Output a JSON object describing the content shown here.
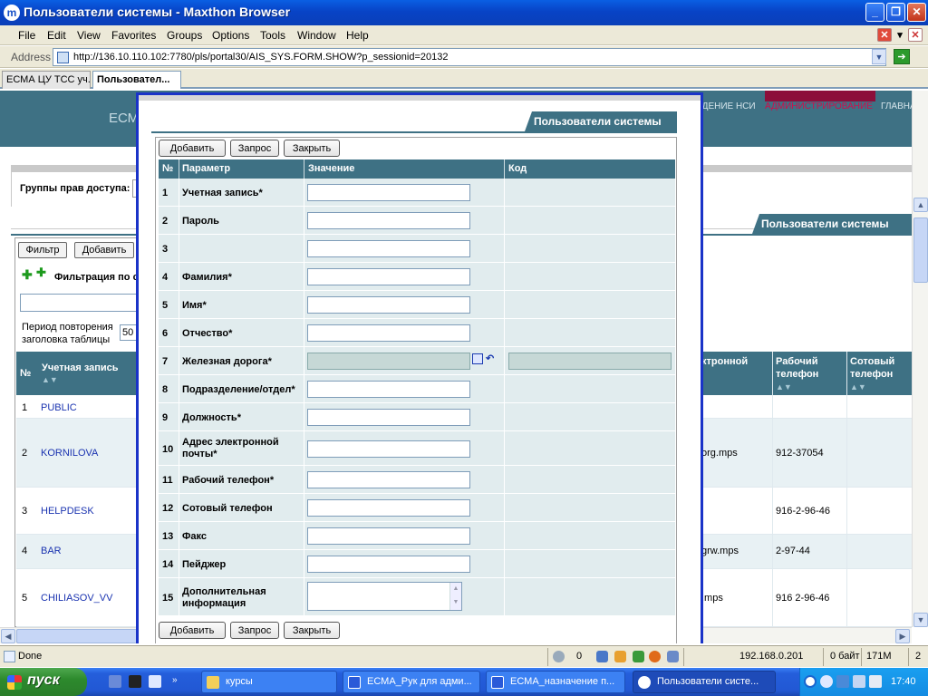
{
  "window": {
    "title": "Пользователи системы - Maxthon Browser",
    "logo": "m"
  },
  "menu": [
    "File",
    "Edit",
    "View",
    "Favorites",
    "Groups",
    "Options",
    "Tools",
    "Window",
    "Help"
  ],
  "address": {
    "label": "Address",
    "url": "http://136.10.110.102:7780/pls/portal30/AIS_SYS.FORM.SHOW?p_sessionid=20132"
  },
  "tabs": [
    {
      "label": "ЕСМА ЦУ ТСС уч..."
    },
    {
      "label": "Пользовател..."
    }
  ],
  "background": {
    "logo": "ЕСМ",
    "nav": {
      "nsi": "ЕДЕНИЕ НСИ",
      "admin": "АДМИНИСТРИРОВАНИЕ",
      "home": "ГЛАВНАЯ"
    },
    "groups_label": "Группы прав доступа:",
    "tab_title": "Пользователи системы",
    "filter_button": "Фильтр",
    "add_button": "Добавить",
    "filter_text": "Фильтрация по с",
    "period_label": "Период повторения заголовка таблицы",
    "period_value": "50",
    "table_headers": {
      "no": "№",
      "account": "Учетная запись",
      "email": "ктронной",
      "work_phone": "Рабочий телефон",
      "mobile": "Сотовый телефон"
    },
    "rows": [
      {
        "no": "1",
        "account": "PUBLIC",
        "email": "",
        "work_phone": ""
      },
      {
        "no": "2",
        "account": "KORNILOVA",
        "email": "org.mps",
        "work_phone": "912-37054"
      },
      {
        "no": "3",
        "account": "HELPDESK",
        "email": "",
        "work_phone": "916-2-96-46"
      },
      {
        "no": "4",
        "account": "BAR",
        "email": "grw.mps",
        "work_phone": "2-97-44"
      },
      {
        "no": "5",
        "account": "CHILIASOV_VV",
        "email": ".mps",
        "work_phone": "916 2-96-46"
      }
    ]
  },
  "modal": {
    "tab_title": "Пользователи системы",
    "buttons": {
      "add": "Добавить",
      "query": "Запрос",
      "close": "Закрыть"
    },
    "headers": {
      "no": "№",
      "param": "Параметр",
      "value": "Значение",
      "code": "Код"
    },
    "fields": [
      {
        "no": "1",
        "label": "Учетная запись*"
      },
      {
        "no": "2",
        "label": "Пароль"
      },
      {
        "no": "3",
        "label": ""
      },
      {
        "no": "4",
        "label": "Фамилия*"
      },
      {
        "no": "5",
        "label": "Имя*"
      },
      {
        "no": "6",
        "label": "Отчество*"
      },
      {
        "no": "7",
        "label": "Железная дорога*"
      },
      {
        "no": "8",
        "label": "Подразделение/отдел*"
      },
      {
        "no": "9",
        "label": "Должность*"
      },
      {
        "no": "10",
        "label": "Адрес электронной почты*"
      },
      {
        "no": "11",
        "label": "Рабочий телефон*"
      },
      {
        "no": "12",
        "label": "Сотовый телефон"
      },
      {
        "no": "13",
        "label": "Факс"
      },
      {
        "no": "14",
        "label": "Пейджер"
      },
      {
        "no": "15",
        "label": "Дополнительная информация"
      }
    ]
  },
  "status": {
    "text": "Done",
    "count": "0",
    "ip": "192.168.0.201",
    "bytes": "0 байт",
    "memory": "171M",
    "num": "2"
  },
  "taskbar": {
    "start": "пуск",
    "buttons": [
      "курсы",
      "ЕСМА_Рук для адми...",
      "ЕСМА_назначение п...",
      "Пользователи систе..."
    ],
    "clock": "17:40"
  }
}
